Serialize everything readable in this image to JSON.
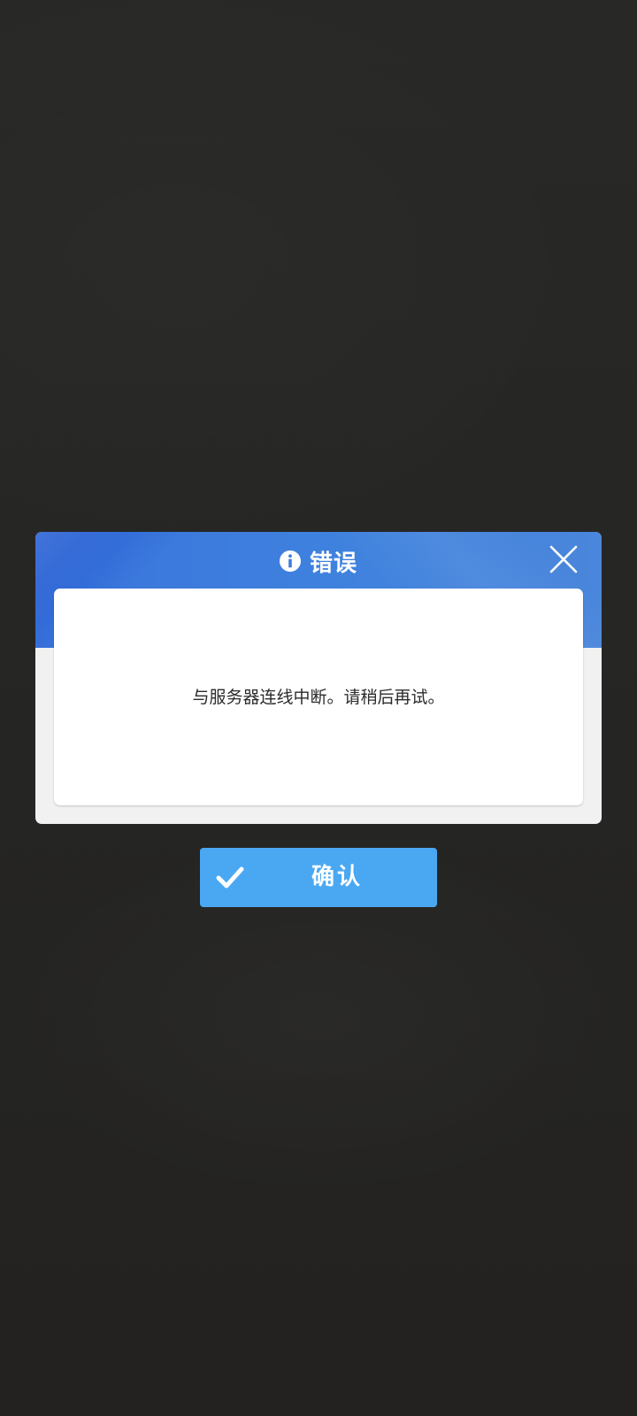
{
  "dialog": {
    "icon": "info-icon",
    "title": "错误",
    "close_icon": "close-icon",
    "message": "与服务器连线中断。请稍后再试。"
  },
  "confirm": {
    "icon": "checkmark-icon",
    "label": "确认"
  },
  "colors": {
    "header_blue": "#3f7ddc",
    "button_blue": "#4aa8f3",
    "backdrop": "#262624",
    "panel_gray": "#f1f1f1"
  }
}
